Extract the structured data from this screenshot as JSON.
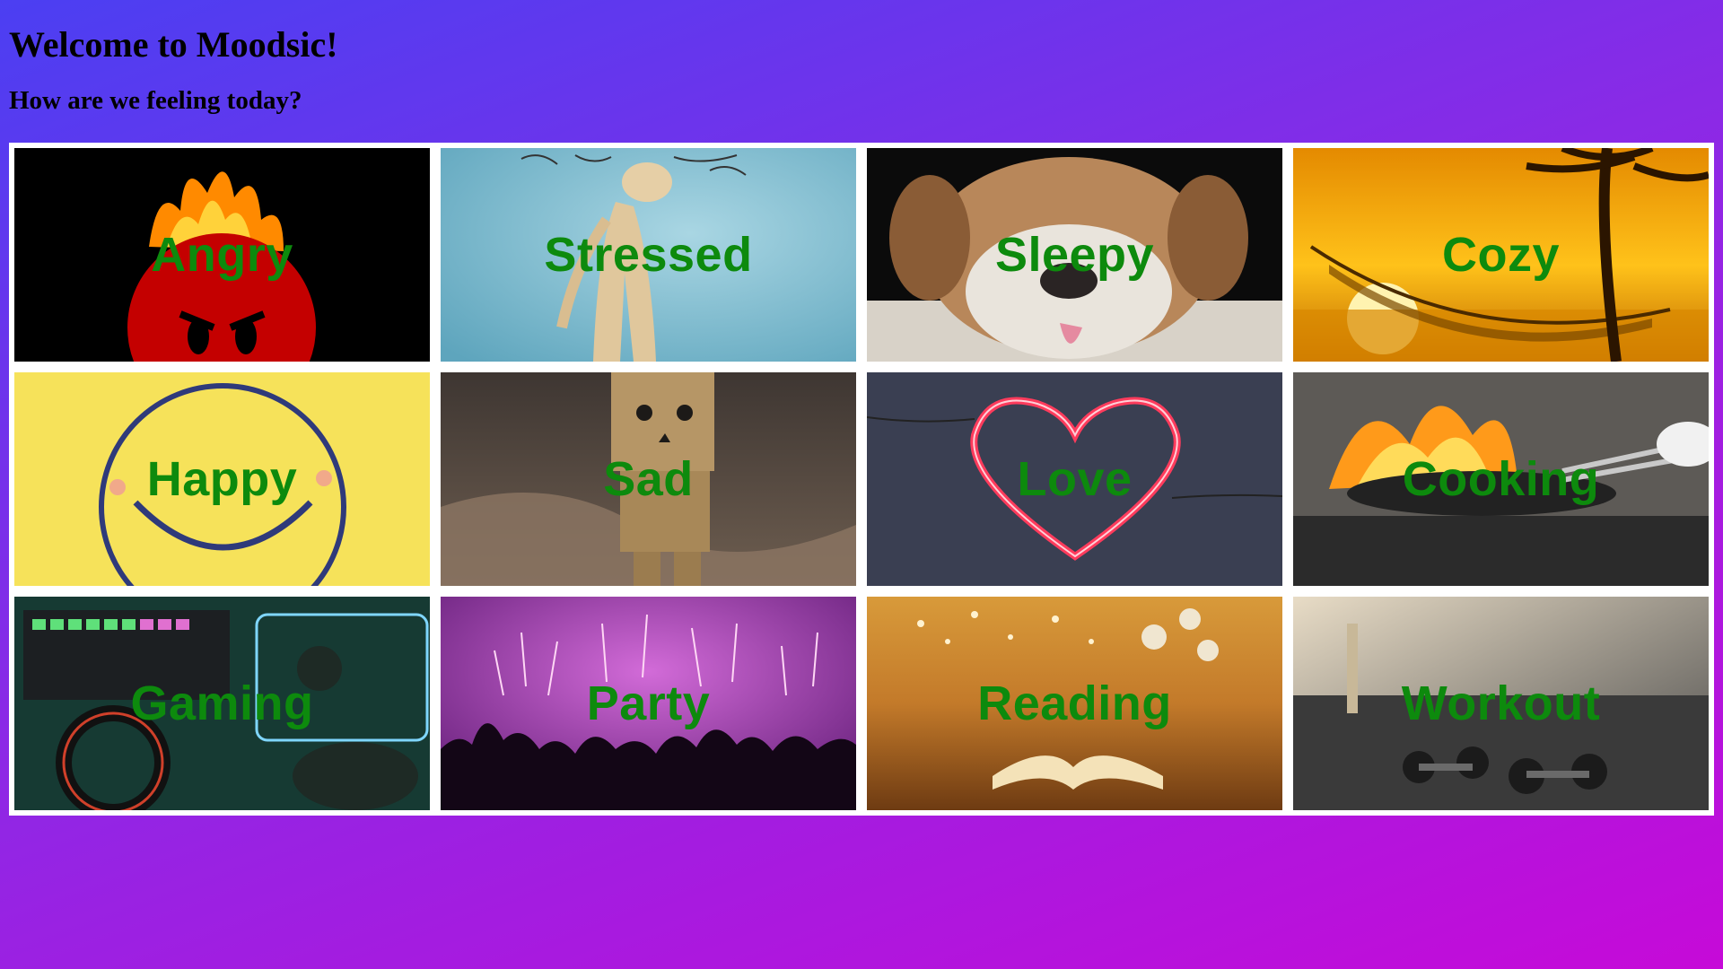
{
  "header": {
    "title": "Welcome to Moodsic!",
    "subtitle": "How are we feeling today?"
  },
  "moods": [
    {
      "label": "Angry",
      "icon": "angry-fire-face"
    },
    {
      "label": "Stressed",
      "icon": "wooden-mannequin"
    },
    {
      "label": "Sleepy",
      "icon": "sleeping-bulldog"
    },
    {
      "label": "Cozy",
      "icon": "hammock-sunset"
    },
    {
      "label": "Happy",
      "icon": "smiley-face"
    },
    {
      "label": "Sad",
      "icon": "cardboard-robot"
    },
    {
      "label": "Love",
      "icon": "neon-heart"
    },
    {
      "label": "Cooking",
      "icon": "flaming-pan"
    },
    {
      "label": "Gaming",
      "icon": "gaming-setup"
    },
    {
      "label": "Party",
      "icon": "concert-crowd"
    },
    {
      "label": "Reading",
      "icon": "open-book"
    },
    {
      "label": "Workout",
      "icon": "dumbbells"
    }
  ],
  "colors": {
    "label": "#0d8a0d",
    "frame": "#ffffff",
    "gradient_start": "#4b3ff2",
    "gradient_end": "#c60ad8"
  }
}
